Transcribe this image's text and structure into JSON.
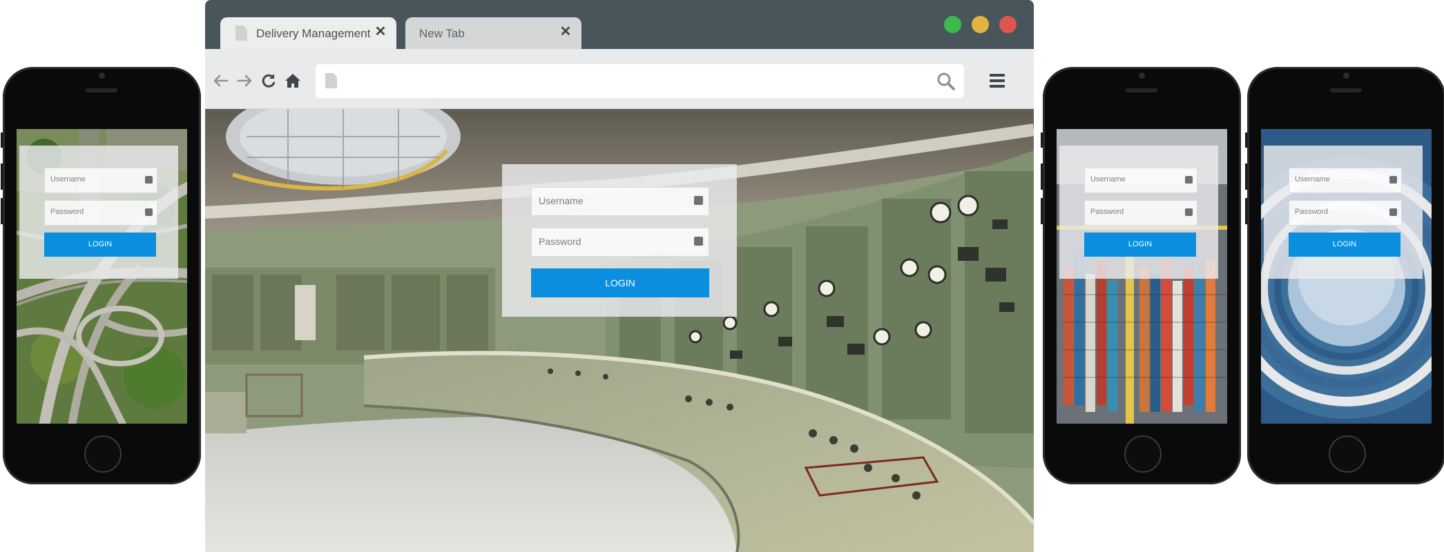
{
  "browser": {
    "tabs": [
      {
        "label": "Delivery Management",
        "active": true
      },
      {
        "label": "New Tab",
        "active": false
      }
    ],
    "close_glyph": "✕",
    "address_value": "",
    "window_controls": [
      "green",
      "yellow",
      "red"
    ],
    "nav_icons": [
      "back-arrow-icon",
      "forward-arrow-icon",
      "reload-icon",
      "home-icon"
    ],
    "colors": {
      "titlebar": "#48555a",
      "toolbar": "#e9eaeb"
    }
  },
  "login": {
    "username_placeholder": "Username",
    "password_placeholder": "Password",
    "button_label": "LOGIN",
    "button_color": "#0b8ede"
  },
  "phones": [
    {
      "login": {
        "username_placeholder": "Username",
        "password_placeholder": "Password",
        "button_label": "LOGIN"
      }
    },
    {
      "login": {
        "username_placeholder": "Username",
        "password_placeholder": "Password",
        "button_label": "LOGIN"
      }
    },
    {
      "login": {
        "username_placeholder": "Username",
        "password_placeholder": "Password",
        "button_label": "LOGIN"
      }
    }
  ]
}
